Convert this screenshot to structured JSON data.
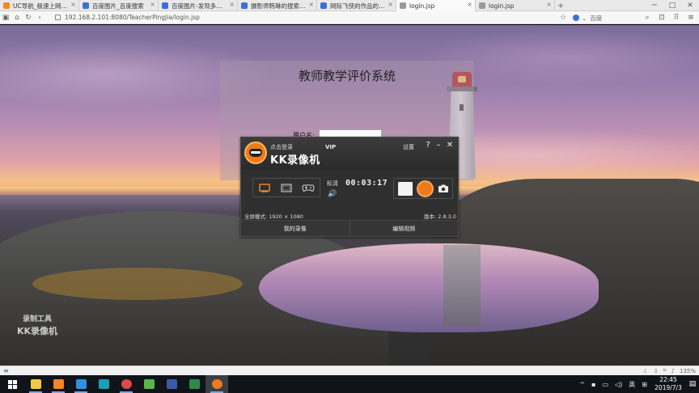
{
  "browser": {
    "tabs": [
      {
        "label": "UC导航_极速上网体验",
        "color": "#f28b1d",
        "active": false
      },
      {
        "label": "百度图片_百度搜索",
        "color": "#3d6fd8",
        "active": false
      },
      {
        "label": "百度图片-发现多彩世界",
        "color": "#3d6fd8",
        "active": false
      },
      {
        "label": "摄影师韩琳的搜索结果",
        "color": "#3d6fd8",
        "active": false
      },
      {
        "label": "网际飞侠的作品的搜索结",
        "color": "#3d6fd8",
        "active": false
      },
      {
        "label": "login.jsp",
        "color": "#9a9a9a",
        "active": true
      },
      {
        "label": "login.jsp",
        "color": "#9a9a9a",
        "active": false
      }
    ],
    "url": "192.168.2.101:8080/TeacherPingJia/login.jsp",
    "search_placeholder": "百度",
    "zoom": "135%",
    "window_controls": {
      "minimize": "─",
      "maximize": "□",
      "close": "✕"
    }
  },
  "page": {
    "title": "教师教学评价系统",
    "username_label": "用户名:",
    "username_value": ""
  },
  "recorder": {
    "login_link": "点击登录",
    "brand": "KK录像机",
    "vip": "VIP",
    "settings": "设置",
    "help": "?",
    "minimize": "–",
    "close": "✕",
    "quality": "标清",
    "timer": "00:03:17",
    "mode_info": "全屏模式: 1920 × 1080",
    "version": "版本: 2.8.3.0",
    "my_recordings": "我的录像",
    "edit_video": "编辑视频"
  },
  "watermark": {
    "line1": "录制工具",
    "line2": "KK录像机"
  },
  "taskbar": {
    "apps": [
      {
        "name": "file-explorer",
        "color": "#f3c64a"
      },
      {
        "name": "app-orange",
        "color": "#f0862a"
      },
      {
        "name": "app-blue-bird",
        "color": "#2f8fe0"
      },
      {
        "name": "app-teal",
        "color": "#1c9fb7"
      },
      {
        "name": "app-chrome-like",
        "color": "#d94b4b"
      },
      {
        "name": "app-green",
        "color": "#57b94b"
      },
      {
        "name": "app-dark-blue",
        "color": "#3a5aa8"
      },
      {
        "name": "app-spreadsheet",
        "color": "#2e8a4a"
      },
      {
        "name": "kk-recorder",
        "color": "#ee7a1c"
      }
    ],
    "tray_expand": "^",
    "ime": "英",
    "time": "22:45",
    "date": "2019/7/3"
  }
}
